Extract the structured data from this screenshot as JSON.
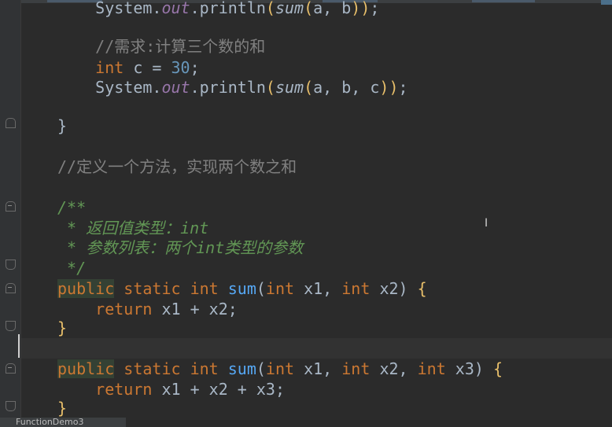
{
  "editor": {
    "lines": [
      {
        "id": "l0",
        "parts": [
          [
            "ident",
            "    System."
          ],
          [
            "static-field",
            "out"
          ],
          [
            "ident",
            ".println"
          ],
          [
            "paren",
            "("
          ],
          [
            "static-call",
            "sum"
          ],
          [
            "paren",
            "("
          ],
          [
            "ident",
            "a, b"
          ],
          [
            "paren",
            ")"
          ],
          [
            "paren",
            ")"
          ],
          [
            "ident",
            ";"
          ]
        ]
      },
      {
        "id": "l1",
        "parts": []
      },
      {
        "id": "l2",
        "parts": [
          [
            "comment",
            "    //需求:计算三个数的和"
          ]
        ]
      },
      {
        "id": "l3",
        "parts": [
          [
            "kw",
            "    int "
          ],
          [
            "ident",
            "c = "
          ],
          [
            "num",
            "30"
          ],
          [
            "ident",
            ";"
          ]
        ]
      },
      {
        "id": "l4",
        "parts": [
          [
            "ident",
            "    System."
          ],
          [
            "static-field",
            "out"
          ],
          [
            "ident",
            ".println"
          ],
          [
            "paren",
            "("
          ],
          [
            "static-call",
            "sum"
          ],
          [
            "paren",
            "("
          ],
          [
            "ident",
            "a, b, c"
          ],
          [
            "paren",
            ")"
          ],
          [
            "paren",
            ")"
          ],
          [
            "ident",
            ";"
          ]
        ]
      },
      {
        "id": "l5",
        "parts": []
      },
      {
        "id": "l6",
        "parts": [
          [
            "brace",
            "}"
          ]
        ]
      },
      {
        "id": "l7",
        "parts": []
      },
      {
        "id": "l8",
        "parts": [
          [
            "comment",
            "//定义一个方法，实现两个数之和"
          ]
        ]
      },
      {
        "id": "l9",
        "parts": []
      },
      {
        "id": "l10",
        "parts": [
          [
            "doc",
            "/**"
          ]
        ]
      },
      {
        "id": "l11",
        "parts": [
          [
            "doc",
            " * 返回值类型：int"
          ]
        ]
      },
      {
        "id": "l12",
        "parts": [
          [
            "doc",
            " * 参数列表：两个int类型的参数"
          ]
        ]
      },
      {
        "id": "l13",
        "parts": [
          [
            "doc",
            " */"
          ]
        ]
      },
      {
        "id": "l14",
        "parts": [
          [
            "kw hl-usage",
            "public"
          ],
          [
            "kw",
            " static int "
          ],
          [
            "sum-fn",
            "sum"
          ],
          [
            "ident",
            "("
          ],
          [
            "kw",
            "int "
          ],
          [
            "ident",
            "x1, "
          ],
          [
            "kw",
            "int "
          ],
          [
            "ident",
            "x2) "
          ],
          [
            "paren",
            "{"
          ]
        ]
      },
      {
        "id": "l15",
        "parts": [
          [
            "kw",
            "    return "
          ],
          [
            "ident",
            "x1 + x2;"
          ]
        ]
      },
      {
        "id": "l16",
        "parts": [
          [
            "paren",
            "}"
          ]
        ]
      },
      {
        "id": "l17",
        "parts": []
      },
      {
        "id": "l18",
        "parts": [
          [
            "kw hl-usage",
            "public"
          ],
          [
            "kw",
            " static int "
          ],
          [
            "sum-fn",
            "sum"
          ],
          [
            "ident",
            "("
          ],
          [
            "kw",
            "int "
          ],
          [
            "ident",
            "x1, "
          ],
          [
            "kw",
            "int "
          ],
          [
            "ident",
            "x2, "
          ],
          [
            "kw",
            "int "
          ],
          [
            "ident",
            "x3) "
          ],
          [
            "paren",
            "{"
          ]
        ]
      },
      {
        "id": "l19",
        "parts": [
          [
            "kw",
            "    return "
          ],
          [
            "ident",
            "x1 + x2 + x3;"
          ]
        ]
      },
      {
        "id": "l20",
        "parts": [
          [
            "paren",
            "}"
          ]
        ]
      }
    ]
  },
  "status": {
    "tab_label": "FunctionDemo3"
  },
  "colors": {
    "background": "#2b2b2b",
    "keyword": "#cc7832",
    "number": "#6897bb",
    "comment": "#808080",
    "doc_comment": "#629755"
  }
}
